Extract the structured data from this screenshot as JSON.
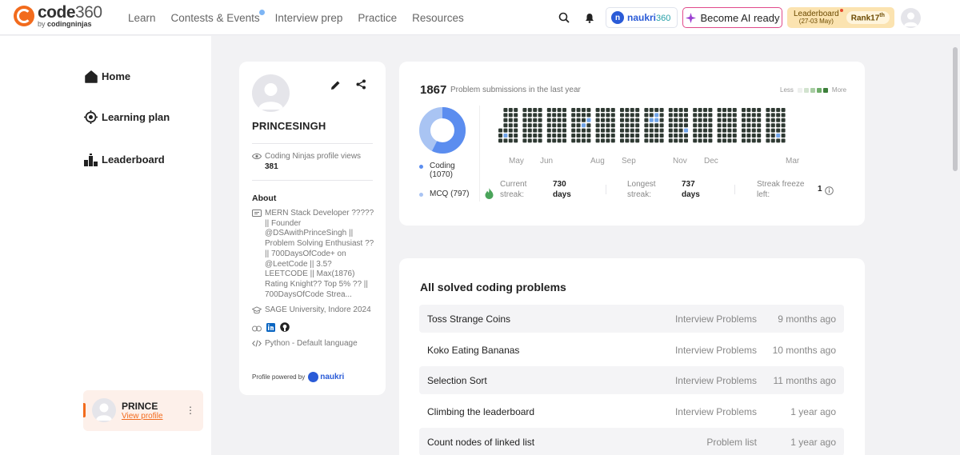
{
  "brand": {
    "name": "code",
    "num": "360",
    "by": "by",
    "sub": "codingninjas"
  },
  "nav": [
    {
      "label": "Learn"
    },
    {
      "label": "Contests & Events"
    },
    {
      "label": "Interview prep"
    },
    {
      "label": "Practice"
    },
    {
      "label": "Resources"
    }
  ],
  "header": {
    "naukri": {
      "name": "naukri",
      "num": "360"
    },
    "ai_button": "Become AI ready",
    "leaderboard": {
      "label": "Leaderboard",
      "dates": "(27-03 May)",
      "rank_prefix": "Rank",
      "rank_num": "17",
      "rank_suffix": "th"
    }
  },
  "sidebar": {
    "items": [
      {
        "label": "Home",
        "icon": "home-icon"
      },
      {
        "label": "Learning plan",
        "icon": "target-icon"
      },
      {
        "label": "Leaderboard",
        "icon": "leaderboard-icon"
      }
    ],
    "user": {
      "name": "PRINCE",
      "link": "View profile",
      "menu": "⋮"
    }
  },
  "profile": {
    "name": "PRINCESINGH",
    "views_label": "Coding Ninjas profile views",
    "views": "381",
    "about_heading": "About",
    "bio": "MERN Stack Developer ????? || Founder @DSAwithPrinceSingh || Problem Solving Enthusiast ?? || 700DaysOfCode+ on @LeetCode || 3.5? LEETCODE || Max(1876) Rating Knight?? Top 5% ?? || 700DaysOfCode Strea...",
    "education": "SAGE University, Indore 2024",
    "language": "Python - Default language",
    "powered_by": "Profile powered by",
    "powered_brand": "naukri"
  },
  "stats": {
    "submissions": "1867",
    "submissions_label": "Problem submissions in the last year",
    "legend_less": "Less",
    "legend_more": "More",
    "coding_label": "Coding",
    "coding_count": "(1070)",
    "mcq_label": "MCQ (797)",
    "coding_value": 1070,
    "mcq_value": 797,
    "months": [
      "May",
      "Jun",
      "Aug",
      "Sep",
      "Nov",
      "Dec",
      "Mar"
    ],
    "current_streak_label_1": "Current",
    "current_streak_label_2": "streak:",
    "current_streak_val_1": "730",
    "current_streak_val_2": "days",
    "longest_streak_label_1": "Longest",
    "longest_streak_label_2": "streak:",
    "longest_streak_val_1": "737",
    "longest_streak_val_2": "days",
    "freeze_label_1": "Streak freeze",
    "freeze_label_2": "left:",
    "freeze_val": "1"
  },
  "solved": {
    "title": "All solved coding problems",
    "rows": [
      {
        "name": "Toss Strange Coins",
        "category": "Interview Problems",
        "time": "9 months ago"
      },
      {
        "name": "Koko Eating Bananas",
        "category": "Interview Problems",
        "time": "10 months ago"
      },
      {
        "name": "Selection Sort",
        "category": "Interview Problems",
        "time": "11 months ago"
      },
      {
        "name": "Climbing the leaderboard",
        "category": "Interview Problems",
        "time": "1 year ago"
      },
      {
        "name": "Count nodes of linked list",
        "category": "Problem list",
        "time": "1 year ago"
      }
    ]
  },
  "colors": {
    "accent": "#f26b1d",
    "naukri": "#2a5bd7",
    "heat_dark": "#2f3a33",
    "heat_blue": "#6fa3e8",
    "pie_coding": "#5b8def",
    "pie_mcq": "#a9c4f3"
  }
}
